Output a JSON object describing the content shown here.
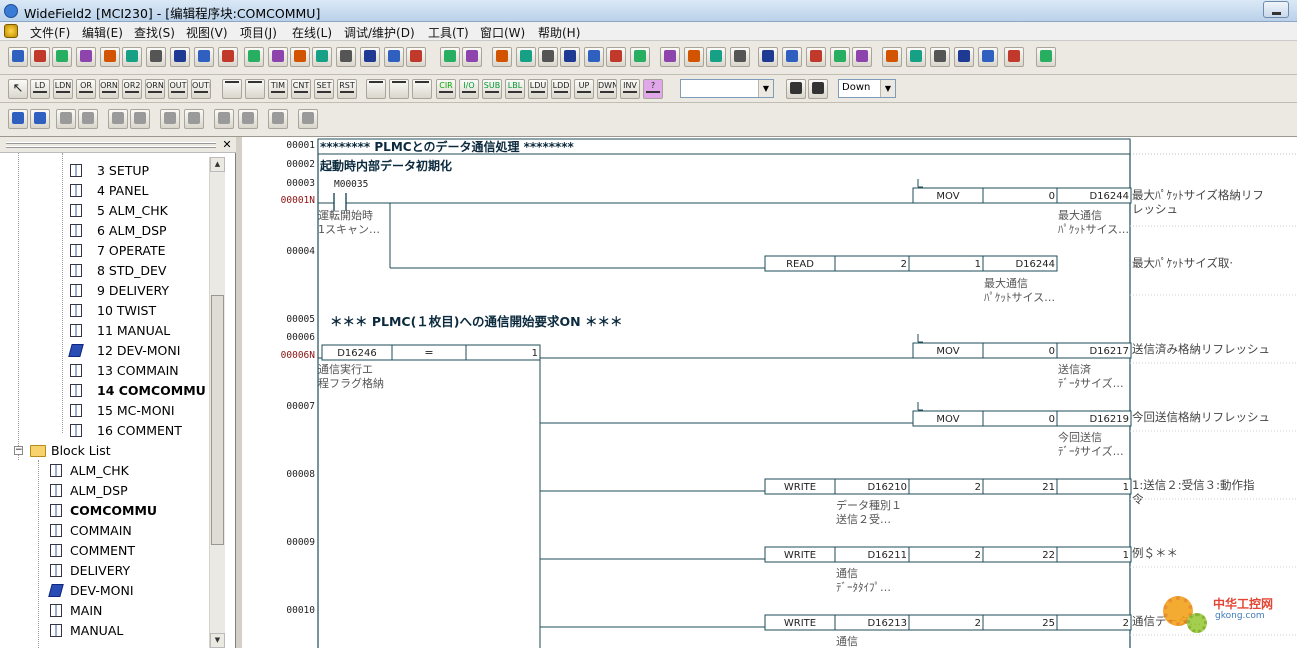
{
  "window": {
    "title": "WideField2 [MCI230] - [编辑程序块:COMCOMMU]"
  },
  "menu": [
    "文件(F)",
    "编辑(E)",
    "查找(S)",
    "视图(V)",
    "项目(J)",
    "在线(L)",
    "调试/维护(D)",
    "工具(T)",
    "窗口(W)",
    "帮助(H)"
  ],
  "toolbar2": {
    "labels": [
      "LD",
      "LDN",
      "OR",
      "ORN",
      "OR2",
      "ORN2",
      "OUT",
      "OUTN",
      "",
      "",
      "TIM",
      "CNT",
      "SET",
      "RST",
      "",
      "",
      "",
      "CIR",
      "I/O",
      "SUB",
      "LBL",
      "LDU",
      "LDD",
      "UP",
      "DWN",
      "INV",
      "?"
    ],
    "search_value": "",
    "direction_value": "Down"
  },
  "tree": {
    "items": [
      {
        "label": "3 SETUP",
        "icon": "book-icon"
      },
      {
        "label": "4 PANEL",
        "icon": "book-icon"
      },
      {
        "label": "5 ALM_CHK",
        "icon": "book-icon"
      },
      {
        "label": "6 ALM_DSP",
        "icon": "book-icon"
      },
      {
        "label": "7 OPERATE",
        "icon": "book-icon"
      },
      {
        "label": "8 STD_DEV",
        "icon": "book-icon"
      },
      {
        "label": "9 DELIVERY",
        "icon": "book-icon"
      },
      {
        "label": "10 TWIST",
        "icon": "book-icon"
      },
      {
        "label": "11 MANUAL",
        "icon": "book-icon"
      },
      {
        "label": "12 DEV-MONI",
        "icon": "book-blue-icon"
      },
      {
        "label": "13 COMMAIN",
        "icon": "book-icon"
      },
      {
        "label": "14 COMCOMMU",
        "icon": "book-icon",
        "selected": true
      },
      {
        "label": "15 MC-MONI",
        "icon": "book-icon"
      },
      {
        "label": "16 COMMENT",
        "icon": "book-icon"
      }
    ],
    "block_list_label": "Block List",
    "blocks": [
      {
        "label": "ALM_CHK",
        "icon": "book-icon"
      },
      {
        "label": "ALM_DSP",
        "icon": "book-icon"
      },
      {
        "label": "COMCOMMU",
        "icon": "book-icon",
        "selected": true
      },
      {
        "label": "COMMAIN",
        "icon": "book-icon"
      },
      {
        "label": "COMMENT",
        "icon": "book-icon"
      },
      {
        "label": "DELIVERY",
        "icon": "book-icon"
      },
      {
        "label": "DEV-MONI",
        "icon": "book-blue-icon"
      },
      {
        "label": "MAIN",
        "icon": "book-icon"
      },
      {
        "label": "MANUAL",
        "icon": "book-icon"
      }
    ]
  },
  "ladder": {
    "comment1": "********  PLMCとのデータ通信処理  ********",
    "comment2": "起動時内部データ初期化",
    "comment3": "＊＊＊  PLMC(１枚目)への通信開始要求ON  ＊＊＊",
    "steps": [
      "00001",
      "00002",
      "00003",
      "00004",
      "00005",
      "00006",
      "00007",
      "00008",
      "00009",
      "00010"
    ],
    "nets": [
      "00001N",
      "00006N"
    ],
    "contact_addr": "M00035",
    "contact_comment": [
      "運転開始時",
      "1スキャン…"
    ],
    "compare": {
      "operand": "D16246",
      "op": "=",
      "value": "1",
      "comment": [
        "通信実行エ",
        "程フラグ格納"
      ]
    },
    "rungs": [
      {
        "instr": "MOV",
        "args": [
          "0",
          "D16244"
        ],
        "comment": [
          "最大通信",
          "ﾊﾟｹｯﾄサイス…"
        ],
        "right": [
          "最大ﾊﾟｹｯﾄサイズ格納リフ",
          "レッシュ"
        ]
      },
      {
        "instr": "READ",
        "args": [
          "2",
          "1",
          "D16244",
          "1"
        ],
        "comment": [
          "最大通信",
          "ﾊﾟｹｯﾄサイス…"
        ],
        "right": [
          "最大ﾊﾟｹｯﾄサイズ取·"
        ]
      },
      {
        "instr": "MOV",
        "args": [
          "0",
          "D16217"
        ],
        "comment": [
          "送信済",
          "ﾃﾞｰﾀサイズ…"
        ],
        "right": [
          "送信済み格納リフレッシュ"
        ]
      },
      {
        "instr": "MOV",
        "args": [
          "0",
          "D16219"
        ],
        "comment": [
          "今回送信",
          "ﾃﾞｰﾀサイズ…"
        ],
        "right": [
          "今回送信格納リフレッシュ"
        ]
      },
      {
        "instr": "WRITE",
        "args": [
          "D16210",
          "2",
          "21",
          "1"
        ],
        "comment": [
          "データ種別１",
          "送信２受…"
        ],
        "right": [
          "1:送信２:受信３:動作指",
          "令"
        ]
      },
      {
        "instr": "WRITE",
        "args": [
          "D16211",
          "2",
          "22",
          "1"
        ],
        "comment": [
          "通信",
          "ﾃﾞｰﾀﾀｲﾌﾟ…"
        ],
        "right": [
          "例＄＊＊"
        ]
      },
      {
        "instr": "WRITE",
        "args": [
          "D16213",
          "2",
          "25",
          "2"
        ],
        "comment": [
          "通信"
        ],
        "right": [
          "通信データ…"
        ]
      }
    ]
  },
  "watermark": {
    "text": "中华工控网",
    "url": "gkong.com"
  }
}
